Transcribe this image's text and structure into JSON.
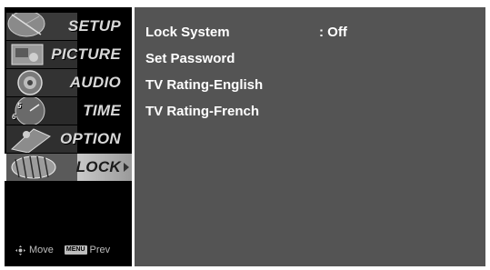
{
  "sidebar": {
    "items": [
      {
        "label": "SETUP",
        "icon": "satellite-dish-icon"
      },
      {
        "label": "PICTURE",
        "icon": "picture-icon"
      },
      {
        "label": "AUDIO",
        "icon": "speaker-icon"
      },
      {
        "label": "TIME",
        "icon": "clock-icon"
      },
      {
        "label": "OPTION",
        "icon": "option-icon"
      },
      {
        "label": "LOCK",
        "icon": "lock-icon",
        "active": true
      }
    ],
    "footer": {
      "move_label": "Move",
      "menu_badge": "MENU",
      "prev_label": "Prev"
    }
  },
  "content": {
    "rows": [
      {
        "label": "Lock System",
        "value": ": Off"
      },
      {
        "label": "Set Password"
      },
      {
        "label": "TV Rating-English"
      },
      {
        "label": "TV Rating-French"
      }
    ]
  },
  "colors": {
    "sidebar_bg": "#000000",
    "content_bg": "#545454",
    "text": "#ffffff",
    "active_highlight": "#dcdcdc"
  }
}
